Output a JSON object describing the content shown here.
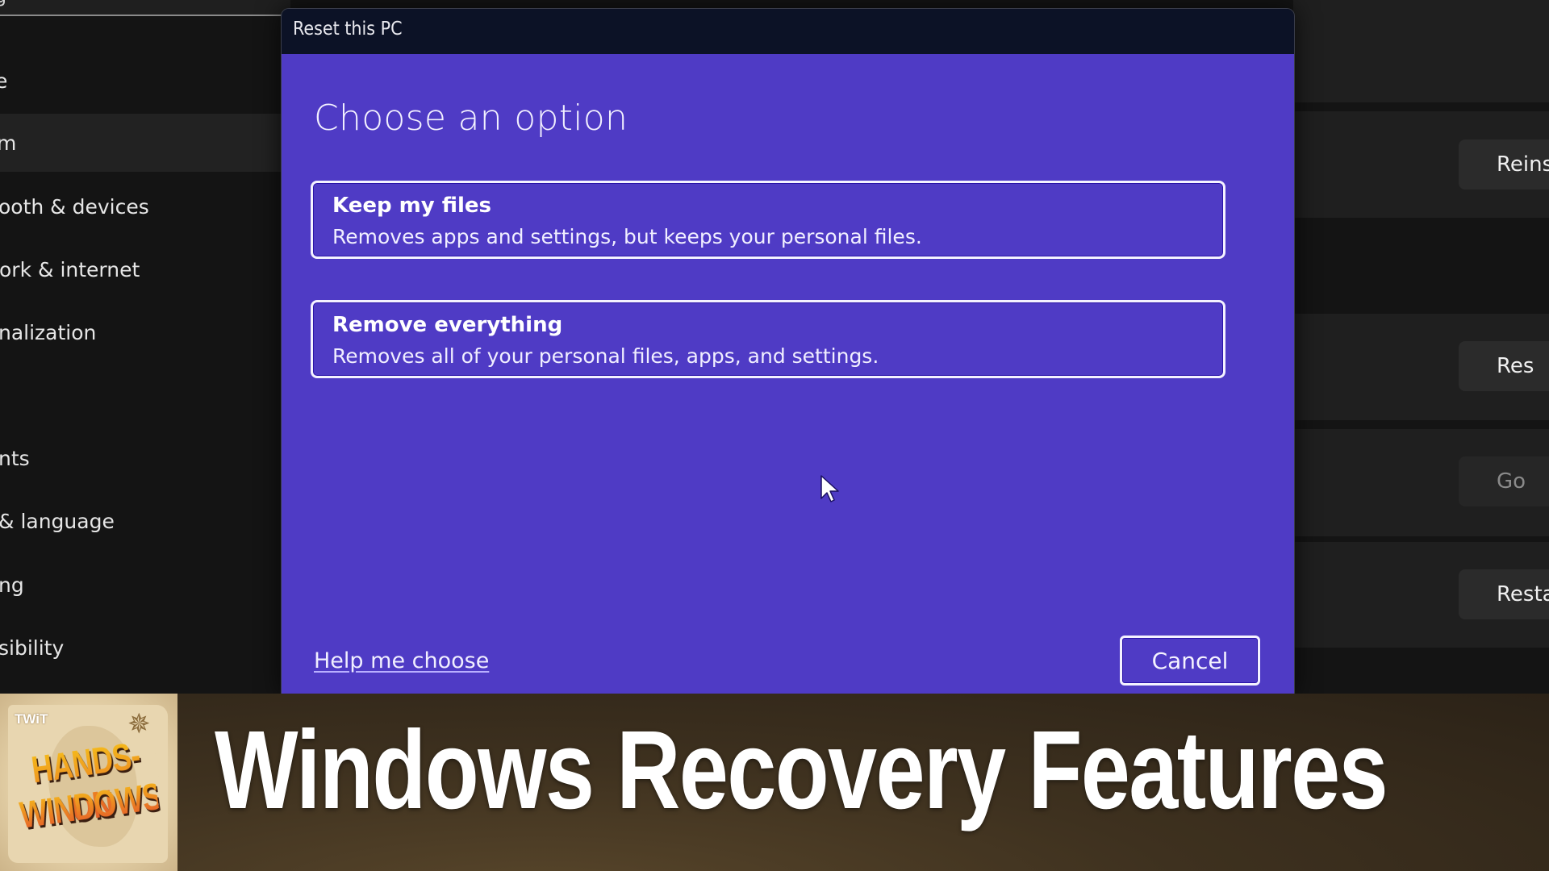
{
  "settings": {
    "search_text": "g",
    "sidebar": {
      "items": [
        {
          "label": "e",
          "selected": false
        },
        {
          "label": "m",
          "selected": true
        },
        {
          "label": "ooth & devices",
          "selected": false
        },
        {
          "label": "ork & internet",
          "selected": false
        },
        {
          "label": "nalization",
          "selected": false
        },
        {
          "label": "",
          "selected": false
        },
        {
          "label": "nts",
          "selected": false
        },
        {
          "label": "& language",
          "selected": false
        },
        {
          "label": "ng",
          "selected": false
        },
        {
          "label": "sibility",
          "selected": false
        }
      ]
    },
    "right_pane": {
      "buttons": [
        {
          "label": "Reinstall now",
          "visible_label": "Reinst",
          "disabled": false
        },
        {
          "label": "Reset PC",
          "visible_label": "Res",
          "disabled": false
        },
        {
          "label": "Go back",
          "visible_label": "Go",
          "disabled": true
        },
        {
          "label": "Restart now",
          "visible_label": "Resta",
          "disabled": false
        }
      ]
    }
  },
  "dialog": {
    "title": "Reset this PC",
    "heading": "Choose an option",
    "options": [
      {
        "title": "Keep my files",
        "description": "Removes apps and settings, but keeps your personal files."
      },
      {
        "title": "Remove everything",
        "description": "Removes all of your personal files, apps, and settings."
      }
    ],
    "help_link": "Help me choose",
    "cancel_label": "Cancel",
    "colors": {
      "body": "#4f3bc5",
      "titlebar": "#0c1226",
      "border": "#f4f2ff"
    }
  },
  "banner": {
    "logo": {
      "brand": "TWiT",
      "line1": "HANDS-ON",
      "line2": "WINDOWS"
    },
    "title": "Windows Recovery Features"
  }
}
